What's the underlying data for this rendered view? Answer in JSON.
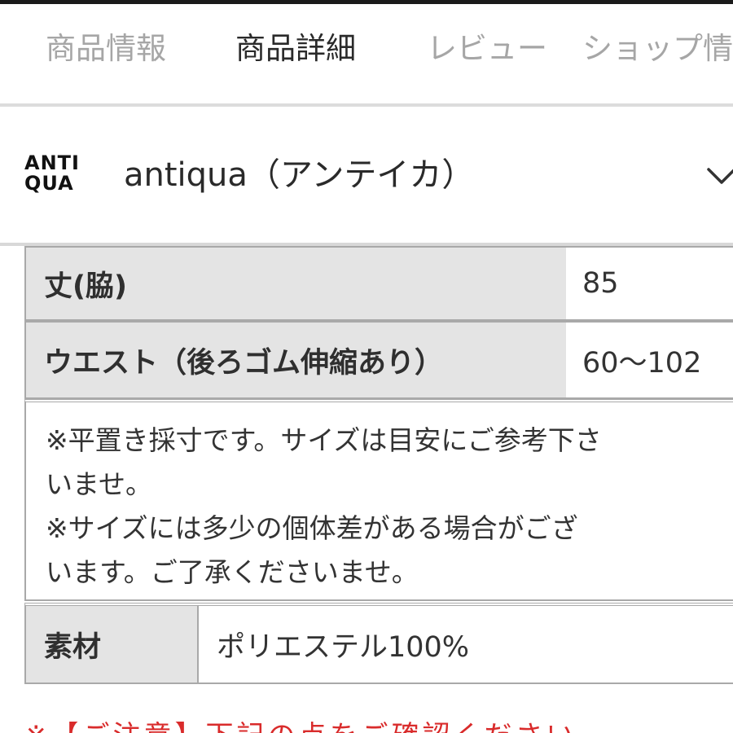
{
  "tabs": [
    {
      "label": "商品情報",
      "active": false
    },
    {
      "label": "商品詳細",
      "active": true
    },
    {
      "label": "レビュー",
      "active": false
    },
    {
      "label": "ショップ情",
      "active": false
    }
  ],
  "brand": {
    "logo_line1": "ANTI",
    "logo_line2": "QUA",
    "name": "antiqua（アンテイカ）",
    "icon": "chevron-down-icon"
  },
  "spec": {
    "rows": [
      {
        "label": "丈(脇)",
        "value": "85"
      },
      {
        "label": "ウエスト（後ろゴム伸縮あり）",
        "value": "60〜102"
      }
    ],
    "note_lines": [
      "※平置き採寸です。サイズは目安にご参考下さ",
      "いませ。",
      "※サイズには多少の個体差がある場合がござ",
      "います。ご了承くださいませ。"
    ],
    "material": {
      "label": "素材",
      "value": "ポリエステル100%"
    }
  },
  "footer_partial_text": "※【ご注意】下記の点をご確認ください",
  "colors": {
    "active_tab": "#2a2a2a",
    "inactive_tab": "#a6a6a6",
    "label_bg": "#e4e4e4",
    "border": "#a9a9a9",
    "footer_red": "#d92b2b"
  }
}
